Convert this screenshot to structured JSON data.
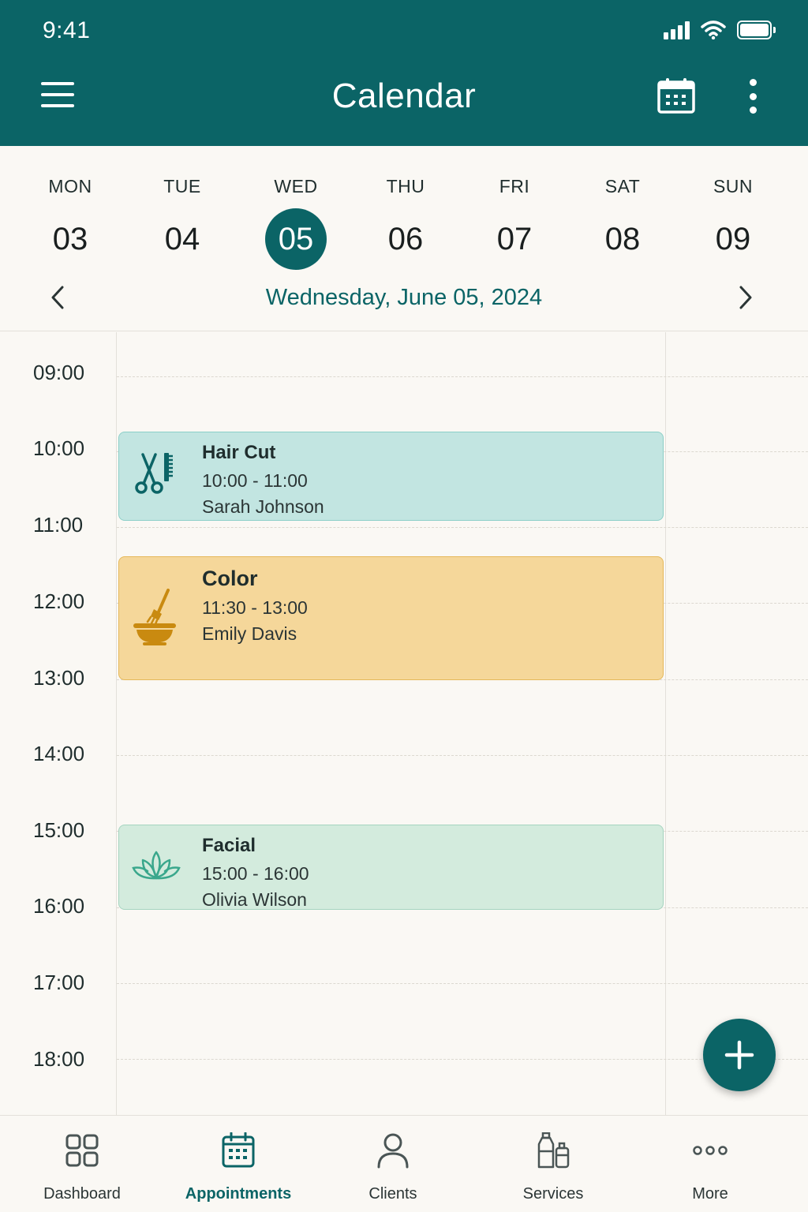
{
  "status": {
    "time": "9:41"
  },
  "header": {
    "title": "Calendar"
  },
  "week": {
    "days": [
      {
        "name": "MON",
        "num": "03"
      },
      {
        "name": "TUE",
        "num": "04"
      },
      {
        "name": "WED",
        "num": "05"
      },
      {
        "name": "THU",
        "num": "06"
      },
      {
        "name": "FRI",
        "num": "07"
      },
      {
        "name": "SAT",
        "num": "08"
      },
      {
        "name": "SUN",
        "num": "09"
      }
    ],
    "selected_index": 2,
    "full_date": "Wednesday, June 05, 2024"
  },
  "timeline": {
    "hours": [
      "09:00",
      "10:00",
      "11:00",
      "12:00",
      "13:00",
      "14:00",
      "15:00",
      "16:00",
      "17:00",
      "18:00"
    ]
  },
  "events": [
    {
      "title": "Hair Cut",
      "time": "10:00 - 11:00",
      "client": "Sarah Johnson",
      "icon": "scissors-comb-icon",
      "color": "#c2e5e1"
    },
    {
      "title": "Color",
      "time": "11:30 - 13:00",
      "client": "Emily Davis",
      "icon": "color-bowl-brush-icon",
      "color": "#f5d79a"
    },
    {
      "title": "Facial",
      "time": "15:00 - 16:00",
      "client": "Olivia Wilson",
      "icon": "lotus-icon",
      "color": "#d3ebdd"
    }
  ],
  "bottom_nav": [
    {
      "label": "Dashboard",
      "icon": "dashboard-grid-icon"
    },
    {
      "label": "Appointments",
      "icon": "calendar-icon",
      "active": true
    },
    {
      "label": "Clients",
      "icon": "person-icon"
    },
    {
      "label": "Services",
      "icon": "bottles-icon"
    },
    {
      "label": "More",
      "icon": "more-dots-icon"
    }
  ],
  "colors": {
    "primary": "#0b6466",
    "background": "#faf8f4"
  }
}
